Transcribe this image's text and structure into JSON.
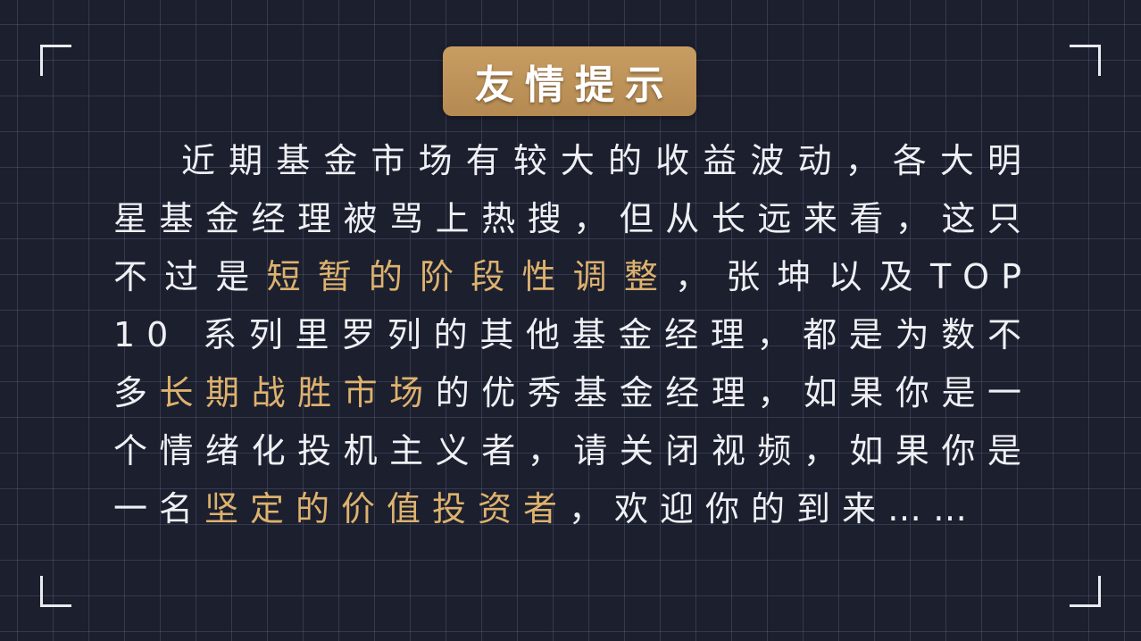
{
  "title": "友情提示",
  "colors": {
    "background": "#1c1f2e",
    "grid": "#8c96b9",
    "badge": "#c89d62",
    "text": "#eef0f4",
    "highlight": "#ddb26e"
  },
  "body": {
    "p1": "近期基金市场有较大的收益波动，各大明星基金经理被骂上热搜，但从长远来看，这只不过是",
    "h1": "短暂的阶段性调整",
    "p2": "，张坤以及TOP 10 系列里罗列的其他基金经理，都是为数不多",
    "h2": "长期战胜市场",
    "p3": "的优秀基金经理，如果你是一个情绪化投机主义者，请关闭视频，如果你是一名",
    "h3": "坚定的价值投资者",
    "p4": "，欢迎你的到来……"
  }
}
